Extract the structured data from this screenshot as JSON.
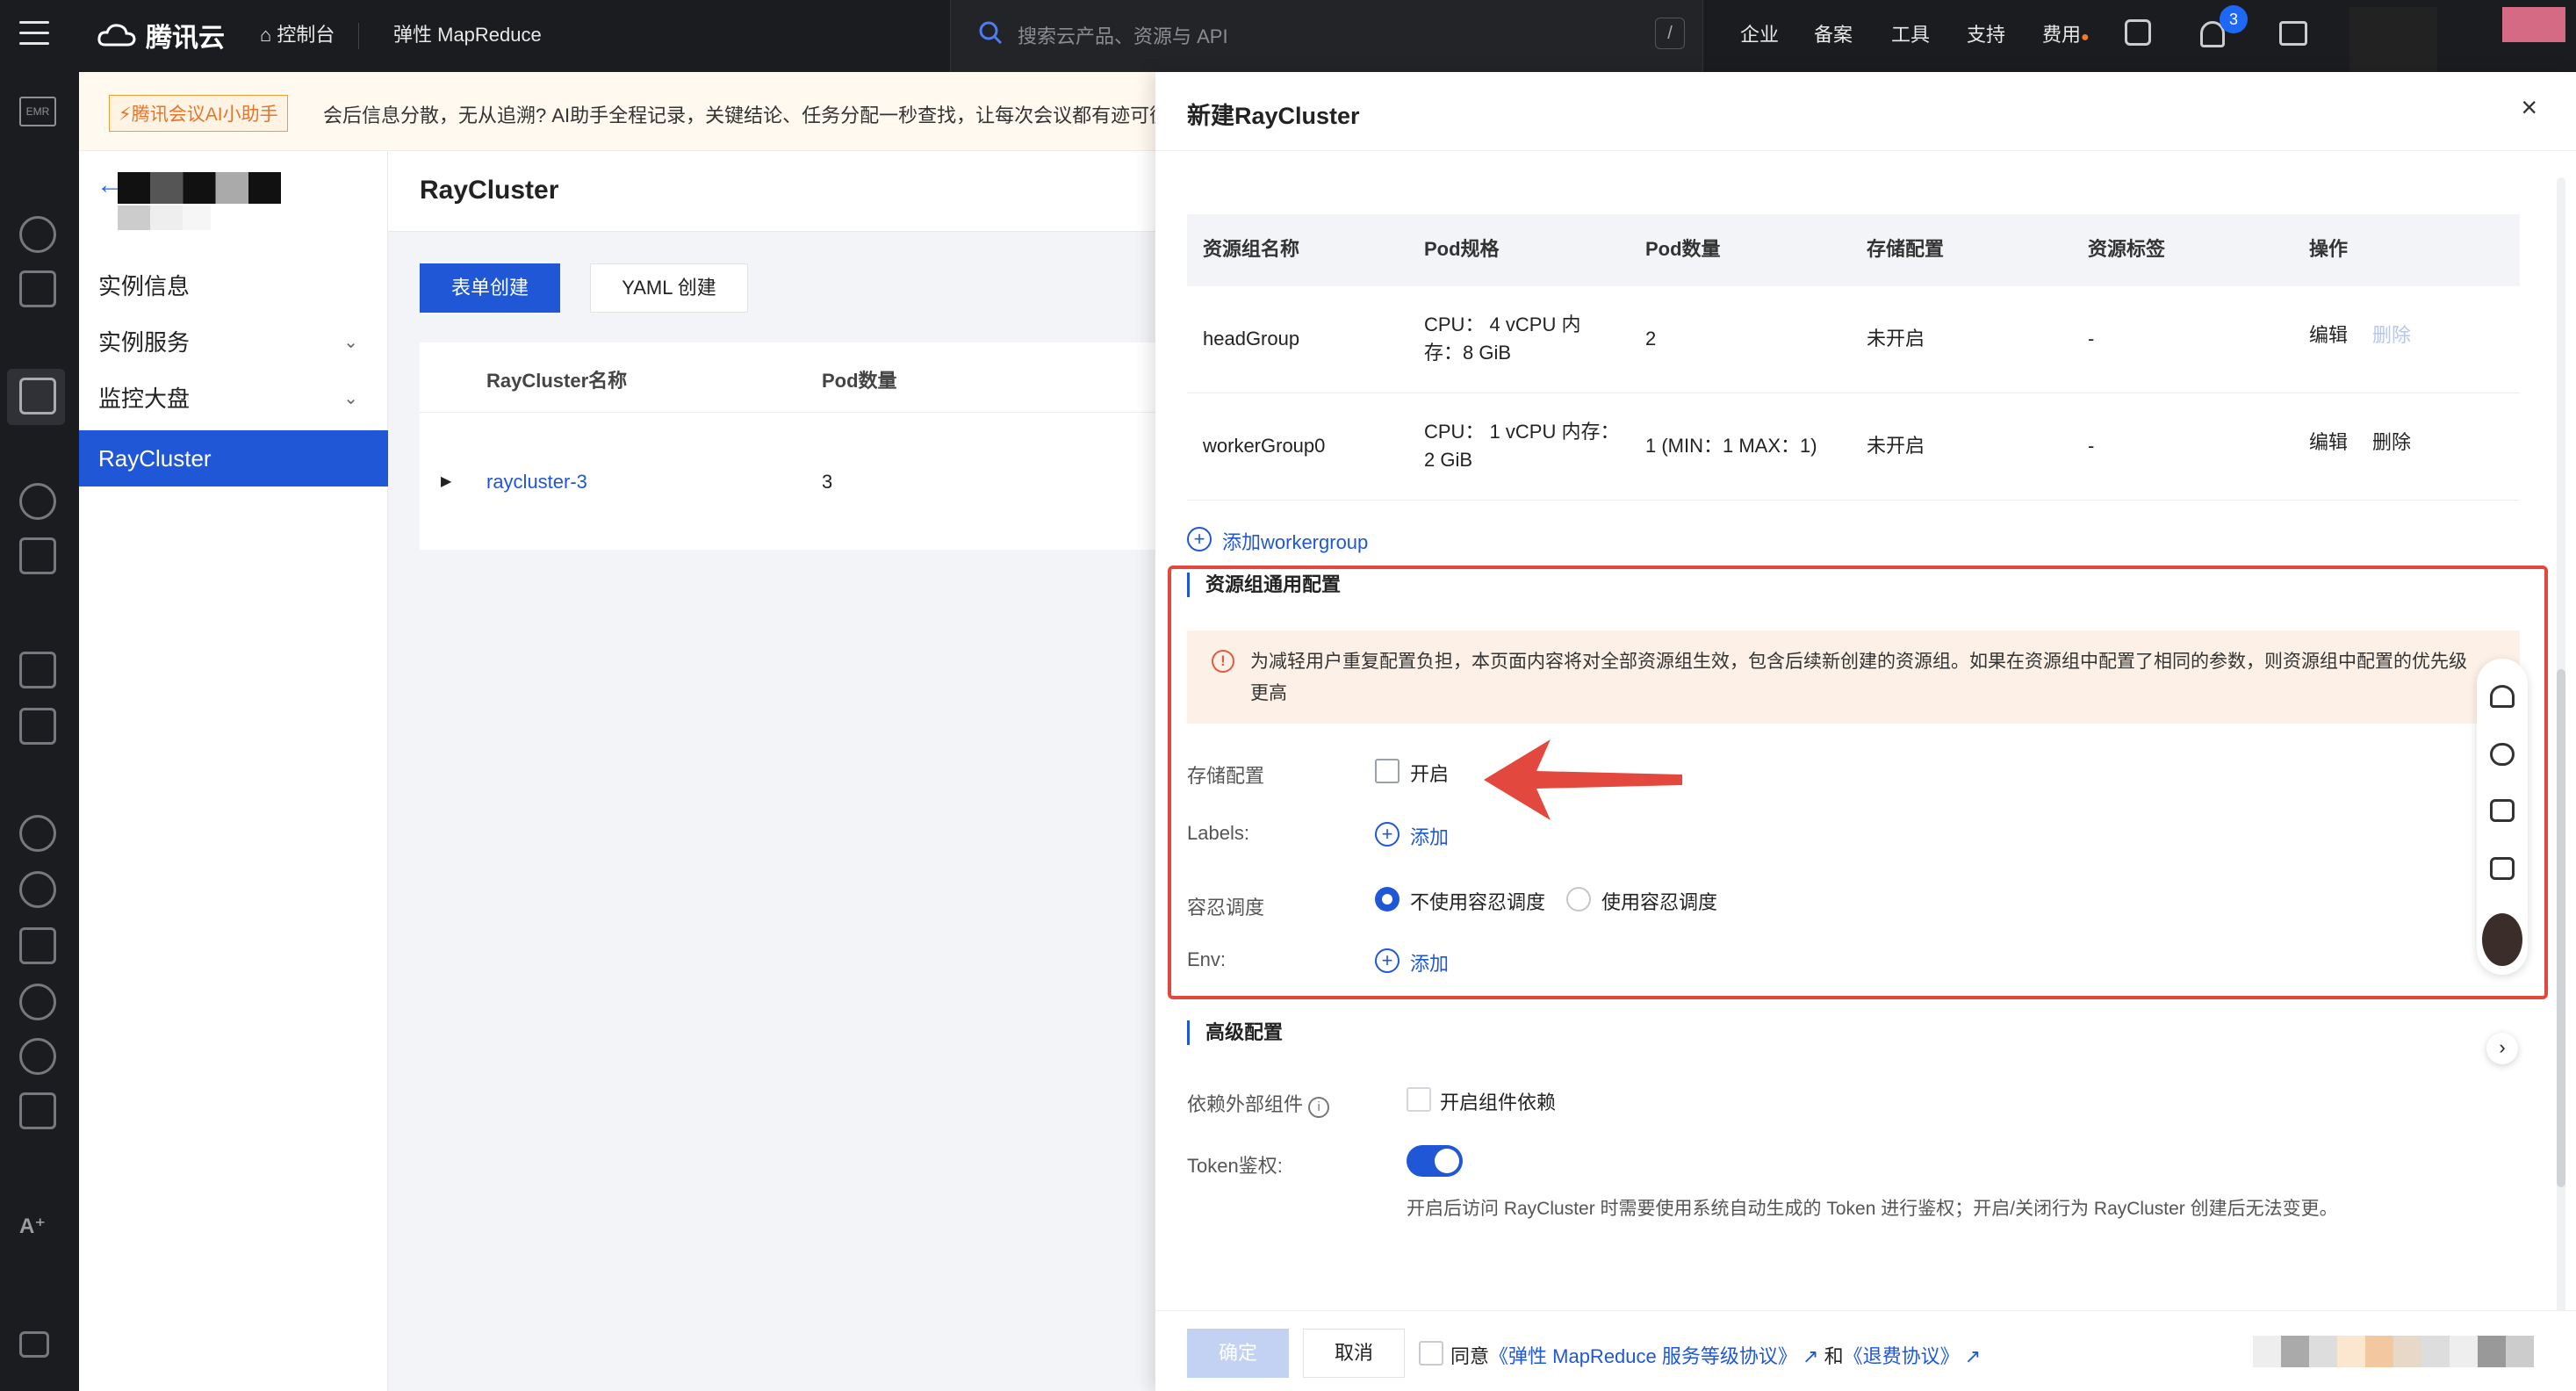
{
  "topbar": {
    "brand": "腾讯云",
    "console": "控制台",
    "product": "弹性 MapReduce",
    "search_placeholder": "搜索云产品、资源与 API",
    "search_shortcut": "/",
    "nav": [
      "企业",
      "备案",
      "工具",
      "支持",
      "费用"
    ],
    "notification_count": "3"
  },
  "banner": {
    "tag": "腾讯会议AI小助手",
    "text": "会后信息分散，无从追溯? AI助手全程记录，关键结论、任务分配一秒查找，让每次会议都有迹可循"
  },
  "sidebar": {
    "items": [
      {
        "label": "实例信息",
        "expandable": false
      },
      {
        "label": "实例服务",
        "expandable": true
      },
      {
        "label": "监控大盘",
        "expandable": true
      },
      {
        "label": "RayCluster",
        "expandable": false,
        "active": true
      }
    ]
  },
  "main": {
    "title": "RayCluster",
    "form_create": "表单创建",
    "yaml_create": "YAML 创建",
    "table": {
      "headers": [
        "RayCluster名称",
        "Pod数量"
      ],
      "rows": [
        {
          "name": "raycluster-3",
          "pods": "3"
        }
      ]
    }
  },
  "drawer": {
    "title": "新建RayCluster",
    "table": {
      "headers": [
        "资源组名称",
        "Pod规格",
        "Pod数量",
        "存储配置",
        "资源标签",
        "操作"
      ],
      "rows": [
        {
          "name": "headGroup",
          "spec": "CPU： 4 vCPU 内存：8 GiB",
          "pods": "2",
          "storage": "未开启",
          "labels": "-",
          "edit": "编辑",
          "delete": "删除",
          "delete_disabled": true
        },
        {
          "name": "workerGroup0",
          "spec": "CPU： 1 vCPU 内存：2 GiB",
          "pods": "1 (MIN：1 MAX：1)",
          "storage": "未开启",
          "labels": "-",
          "edit": "编辑",
          "delete": "删除",
          "delete_disabled": false
        }
      ]
    },
    "add_workergroup": "添加workergroup",
    "common": {
      "title": "资源组通用配置",
      "notice": "为减轻用户重复配置负担，本页面内容将对全部资源组生效，包含后续新创建的资源组。如果在资源组中配置了相同的参数，则资源组中配置的优先级更高",
      "storage_label": "存储配置",
      "storage_enable": "开启",
      "labels_label": "Labels:",
      "add": "添加",
      "toleration_label": "容忍调度",
      "toleration_off": "不使用容忍调度",
      "toleration_on": "使用容忍调度",
      "env_label": "Env:"
    },
    "advanced": {
      "title": "高级配置",
      "dep_label": "依赖外部组件",
      "dep_option": "开启组件依赖",
      "token_label": "Token鉴权:",
      "token_enabled": true,
      "token_hint": "开启后访问 RayCluster 时需要使用系统自动生成的 Token 进行鉴权；开启/关闭行为 RayCluster 创建后无法变更。"
    },
    "footer": {
      "confirm": "确定",
      "cancel": "取消",
      "agree": "同意",
      "agreement1": "《弹性 MapReduce 服务等级协议》",
      "and": "和",
      "agreement2": "《退费协议》"
    }
  },
  "colors": {
    "primary": "#1f57d6",
    "highlight": "#e2483d",
    "notice_bg": "#fdf1e7"
  }
}
